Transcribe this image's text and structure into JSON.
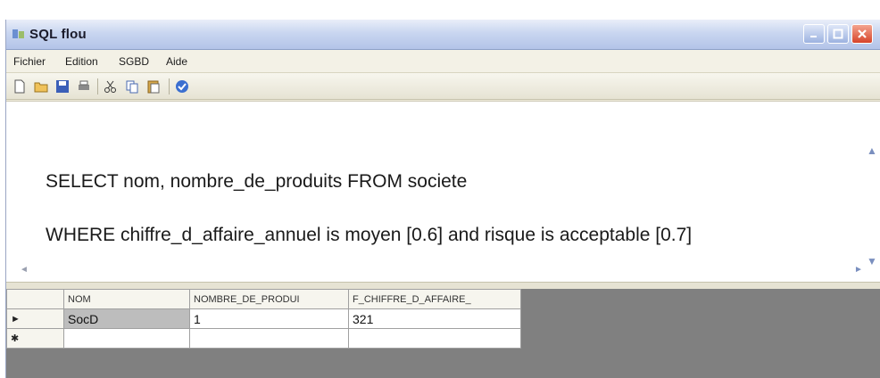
{
  "window": {
    "title": "SQL flou",
    "icon": "sql-app-icon"
  },
  "menu": {
    "items": [
      "Fichier",
      "Edition",
      "SGBD",
      "Aide"
    ]
  },
  "toolbar": {
    "icons": [
      "new-document-icon",
      "open-folder-icon",
      "save-icon",
      "print-icon",
      "cut-icon",
      "copy-icon",
      "paste-icon",
      "execute-icon"
    ]
  },
  "editor": {
    "line1": "SELECT nom, nombre_de_produits FROM societe",
    "line2": "WHERE chiffre_d_affaire_annuel is moyen [0.6] and risque is acceptable [0.7]"
  },
  "grid": {
    "columns": [
      "NOM",
      "NOMBRE_DE_PRODUI",
      "F_CHIFFRE_D_AFFAIRE_"
    ],
    "rows": [
      {
        "marker": "►",
        "cells": [
          "SocD",
          "1",
          "321"
        ]
      },
      {
        "marker": "✱",
        "cells": [
          "",
          "",
          ""
        ]
      }
    ]
  }
}
